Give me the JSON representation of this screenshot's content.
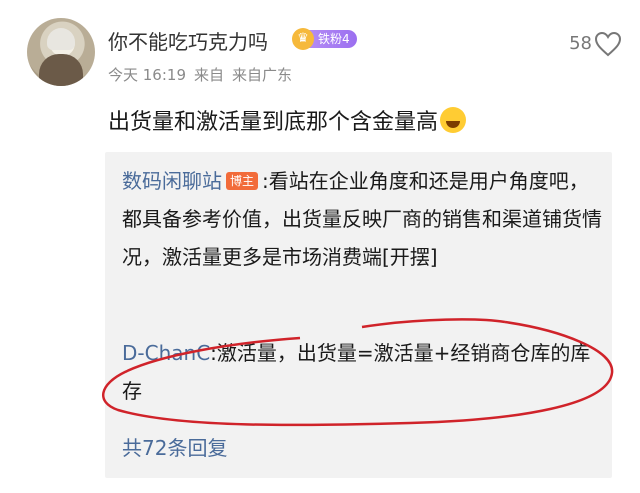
{
  "comment": {
    "username": "你不能吃巧克力吗",
    "fan_badge": "铁粉4",
    "time": "今天 16:19",
    "source": "来自",
    "location": "来自广东",
    "likes": "58",
    "text": "出货量和激活量到底那个含金量高"
  },
  "replies": [
    {
      "author": "数码闲聊站",
      "badge": "博主",
      "text": ":看站在企业角度和还是用户角度吧，都具备参考价值，出货量反映厂商的销售和渠道铺货情况，激活量更多是市场消费端[开摆]"
    },
    {
      "author": "D-ChanC",
      "text": ":激活量，出货量=激活量+经销商仓库的库存"
    }
  ],
  "total_replies": "共72条回复",
  "colors": {
    "annotation": "#d0232a",
    "link": "#4a6b9a"
  }
}
